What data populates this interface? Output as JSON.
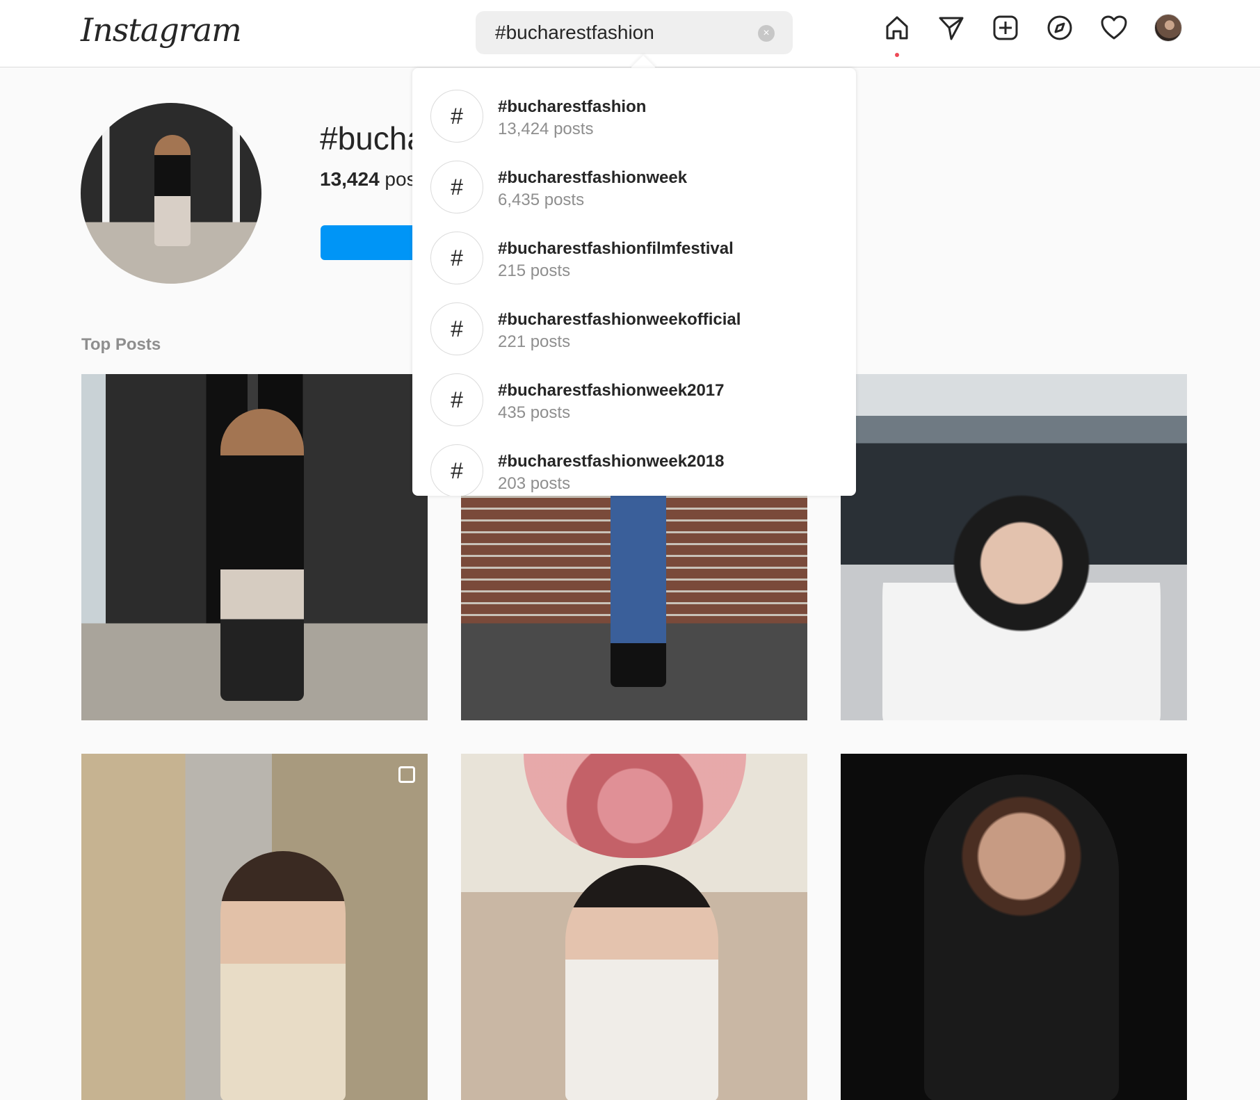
{
  "nav": {
    "logo": "Instagram",
    "search_value": "#bucharestfashion",
    "clear_icon": "×",
    "icons": [
      "home-icon",
      "direct-send-icon",
      "new-post-icon",
      "explore-compass-icon",
      "activity-heart-icon"
    ],
    "notification_color": "#ed4956"
  },
  "header": {
    "title": "#bucharestfashion",
    "post_count": "13,424",
    "post_word": "posts",
    "follow_color": "#0095f6"
  },
  "section": {
    "top_posts_label": "Top Posts"
  },
  "search_results": [
    {
      "symbol": "#",
      "name": "#bucharestfashion",
      "count": "13,424 posts"
    },
    {
      "symbol": "#",
      "name": "#bucharestfashionweek",
      "count": "6,435 posts"
    },
    {
      "symbol": "#",
      "name": "#bucharestfashionfilmfestival",
      "count": "215 posts"
    },
    {
      "symbol": "#",
      "name": "#bucharestfashionweekofficial",
      "count": "221 posts"
    },
    {
      "symbol": "#",
      "name": "#bucharestfashionweek2017",
      "count": "435 posts"
    },
    {
      "symbol": "#",
      "name": "#bucharestfashionweek2018",
      "count": "203 posts"
    }
  ]
}
